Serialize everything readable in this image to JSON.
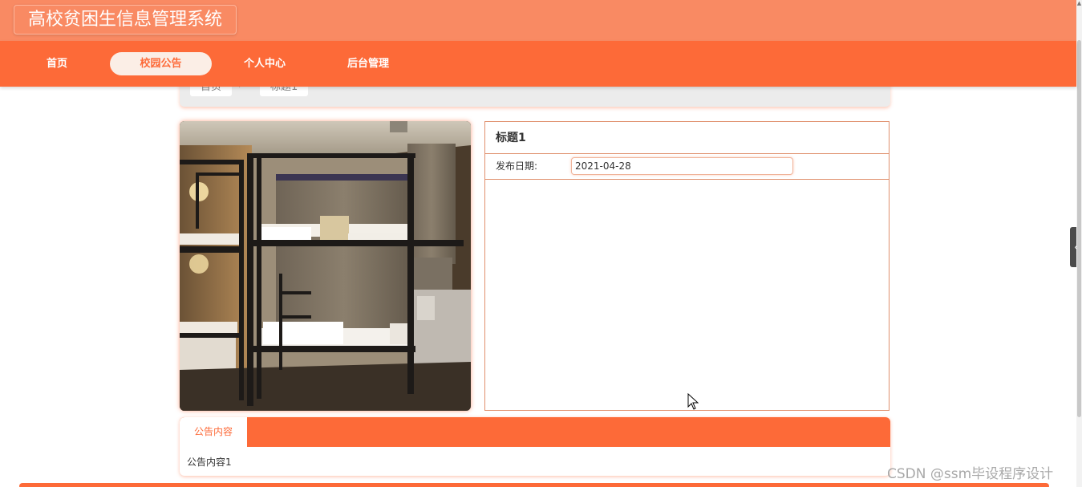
{
  "app": {
    "title": "高校贫困生信息管理系统"
  },
  "nav": {
    "items": [
      {
        "label": "首页",
        "active": false
      },
      {
        "label": "校园公告",
        "active": true
      },
      {
        "label": "个人中心",
        "active": false
      },
      {
        "label": "后台管理",
        "active": false
      }
    ]
  },
  "breadcrumb": {
    "home": "首页",
    "separator": "›",
    "current": "标题1"
  },
  "detail": {
    "title": "标题1",
    "publish_date_label": "发布日期:",
    "publish_date_value": "2021-04-28"
  },
  "content_tab": {
    "tab_label": "公告内容",
    "text": "公告内容1"
  },
  "watermark": "CSDN @ssm毕设程序设计",
  "colors": {
    "nav_bg": "#fd6a38",
    "topbar_bg": "#f98a63",
    "accent": "#fd6a38"
  }
}
